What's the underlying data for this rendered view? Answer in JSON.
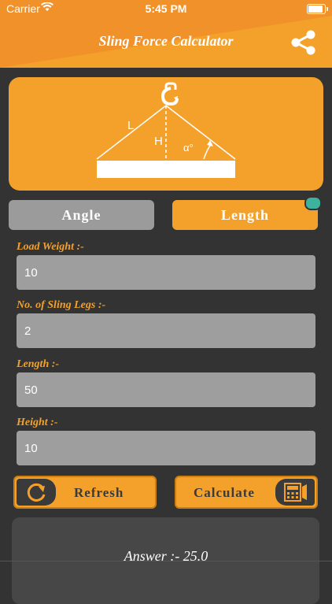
{
  "status_bar": {
    "carrier": "Carrier",
    "time": "5:45 PM"
  },
  "header": {
    "title": "Sling Force Calculator",
    "share_icon": "share-icon"
  },
  "diagram": {
    "label_length": "L",
    "label_height": "H",
    "label_angle": "α°"
  },
  "mode_tabs": {
    "angle_label": "Angle",
    "length_label": "Length",
    "selected": "Length"
  },
  "form": {
    "load_weight_label": "Load Weight :-",
    "load_weight_value": "10",
    "sling_legs_label": "No. of Sling Legs :-",
    "sling_legs_value": "2",
    "length_label": "Length :-",
    "length_value": "50",
    "height_label": "Height :-",
    "height_value": "10"
  },
  "actions": {
    "refresh_label": "Refresh",
    "calculate_label": "Calculate"
  },
  "result": {
    "answer_text": "Answer :- 25.0"
  },
  "colors": {
    "accent": "#F4A12C",
    "background": "#333333",
    "field": "#9E9E9E",
    "toggle_dot": "#3DB39E"
  }
}
